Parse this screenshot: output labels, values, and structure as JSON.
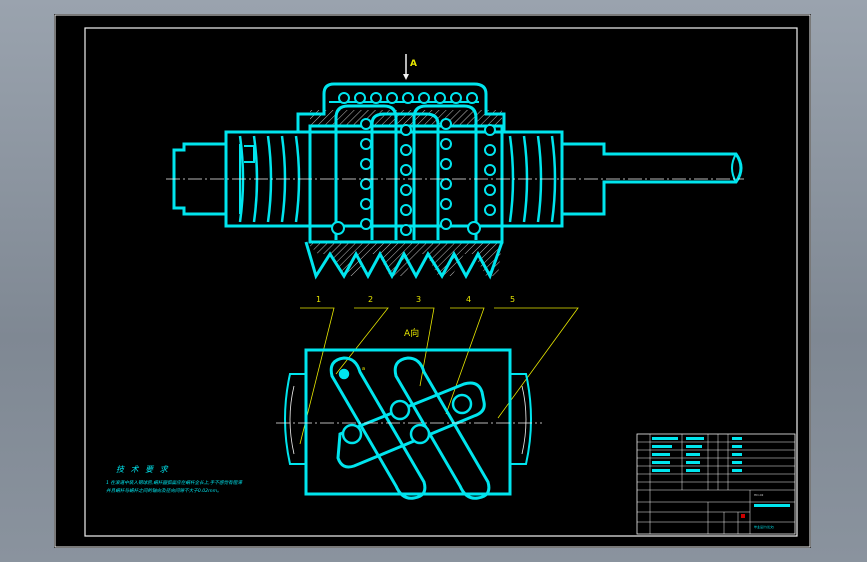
{
  "view_labels": {
    "section_mark": "A",
    "view_title": "A向"
  },
  "callouts": [
    "1",
    "2",
    "3",
    "4",
    "5"
  ],
  "notes": {
    "heading": "技 术 要 求",
    "line1": "1  在滚道中装入钢球后,蜗杆圆弧面应在蜗杆全长上,手不感觉有阻滞",
    "line2": "   并且蜗杆与蜗杆之间的轴向及径向间隙不大于0.02mm。"
  },
  "title_block": {
    "drawing_code": "HD-02",
    "footer_code": "毕业设计(论文)"
  },
  "colors": {
    "outline": "#00e5ee",
    "centerline": "#f2f2f2",
    "leader": "#e6e600",
    "hatch": "#f2f2f2",
    "sheet": "#000000"
  }
}
